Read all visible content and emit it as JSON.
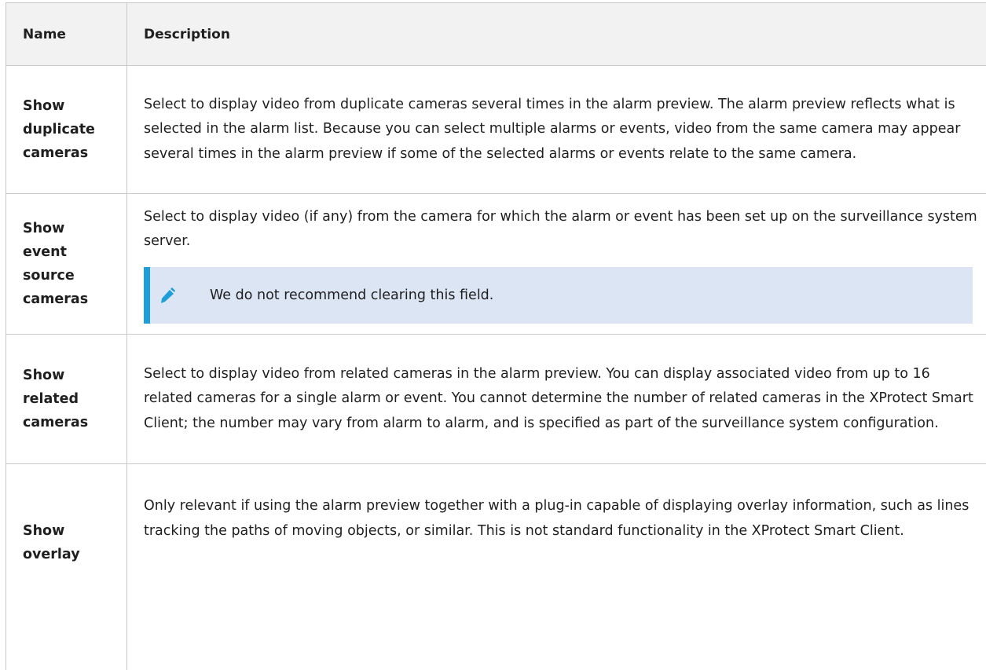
{
  "table": {
    "headers": {
      "name": "Name",
      "description": "Description"
    },
    "rows": [
      {
        "name": "Show duplicate cameras",
        "name_lines": [
          "Show",
          "duplicate",
          "cameras"
        ],
        "description": "Select to display video from duplicate cameras several times in the alarm preview. The alarm preview reflects what is selected in the alarm list. Because you can select multiple alarms or events, video from the same camera may appear several times in the alarm preview if some of the selected alarms or events relate to the same camera."
      },
      {
        "name": "Show event source cameras",
        "name_lines": [
          "Show",
          "event",
          "source",
          "cameras"
        ],
        "description": "Select to display video (if any) from the camera for which the alarm or event has been set up on the surveillance system server.",
        "note": {
          "icon": "pencil-icon",
          "text": "We do not recommend clearing this field."
        }
      },
      {
        "name": "Show related cameras",
        "name_lines": [
          "Show",
          "related",
          "cameras"
        ],
        "description": "Select to display video from related cameras in the alarm preview. You can display associated video from up to 16 related cameras for a single alarm or event. You cannot determine the number of related cameras in the XProtect Smart Client; the number may vary from alarm to alarm, and is specified as part of the surveillance system configuration."
      },
      {
        "name": "Show overlay",
        "name_lines": [
          "Show",
          "overlay"
        ],
        "description": "Only relevant if using the alarm preview together with a plug-in capable of displaying overlay information, such as lines tracking the paths of moving objects, or similar. This is not standard functionality in the XProtect Smart Client."
      }
    ]
  },
  "colors": {
    "accent": "#1c9ed8",
    "note_bg": "#dce5f4",
    "header_bg": "#f2f2f2",
    "border": "#c8c8c8"
  }
}
